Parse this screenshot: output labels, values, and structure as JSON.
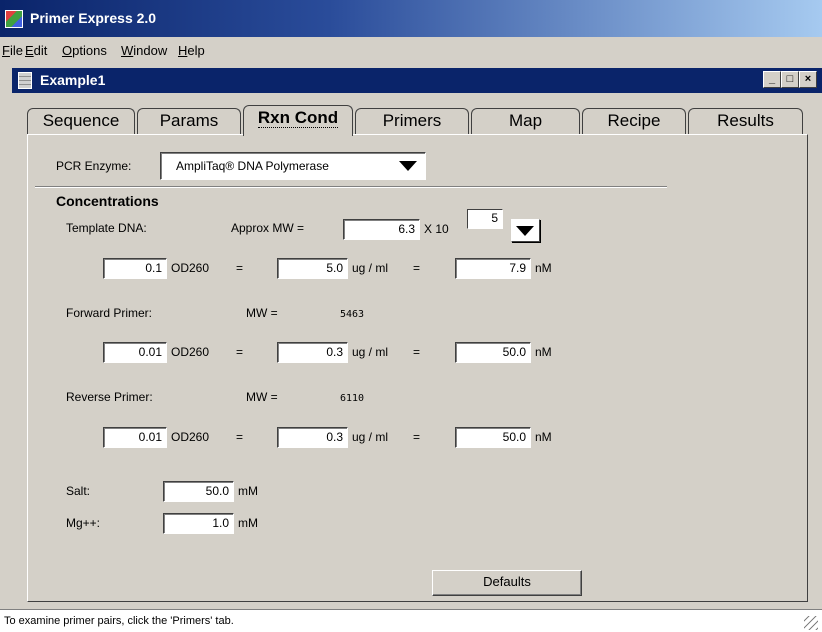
{
  "app": {
    "title": "Primer Express  2.0"
  },
  "menu": [
    {
      "mnemonic": "F",
      "rest": "ile"
    },
    {
      "mnemonic": "E",
      "rest": "dit"
    },
    {
      "mnemonic": "O",
      "rest": "ptions"
    },
    {
      "mnemonic": "W",
      "rest": "indow"
    },
    {
      "mnemonic": "H",
      "rest": "elp"
    }
  ],
  "child_window": {
    "title": "Example1",
    "min": "_",
    "max": "□",
    "close": "×"
  },
  "tabs": [
    "Sequence",
    "Params",
    "Rxn Cond",
    "Primers",
    "Map",
    "Recipe",
    "Results"
  ],
  "active_tab": "Rxn Cond",
  "pcr_enzyme": {
    "label": "PCR Enzyme:",
    "value": "AmpliTaq® DNA Polymerase"
  },
  "concentrations": {
    "heading": "Concentrations",
    "template": {
      "label": "Template DNA:",
      "mw_label": "Approx MW =",
      "mw_value": "6.3",
      "x10": "X 10",
      "exponent": "5",
      "od": "0.1",
      "ugml": "5.0",
      "nm": "7.9"
    },
    "forward": {
      "label": "Forward Primer:",
      "mw_label": "MW =",
      "mw_value": "5463",
      "od": "0.01",
      "ugml": "0.3",
      "nm": "50.0"
    },
    "reverse": {
      "label": "Reverse Primer:",
      "mw_label": "MW =",
      "mw_value": "6110",
      "od": "0.01",
      "ugml": "0.3",
      "nm": "50.0"
    },
    "units": {
      "od260": "OD260",
      "eq": "=",
      "ugml": "ug / ml",
      "nm": "nM"
    }
  },
  "salt": {
    "label": "Salt:",
    "value": "50.0",
    "unit": "mM"
  },
  "mg": {
    "label": "Mg++:",
    "value": "1.0",
    "unit": "mM"
  },
  "defaults_button": "Defaults",
  "status": "To examine primer pairs, click the 'Primers' tab."
}
